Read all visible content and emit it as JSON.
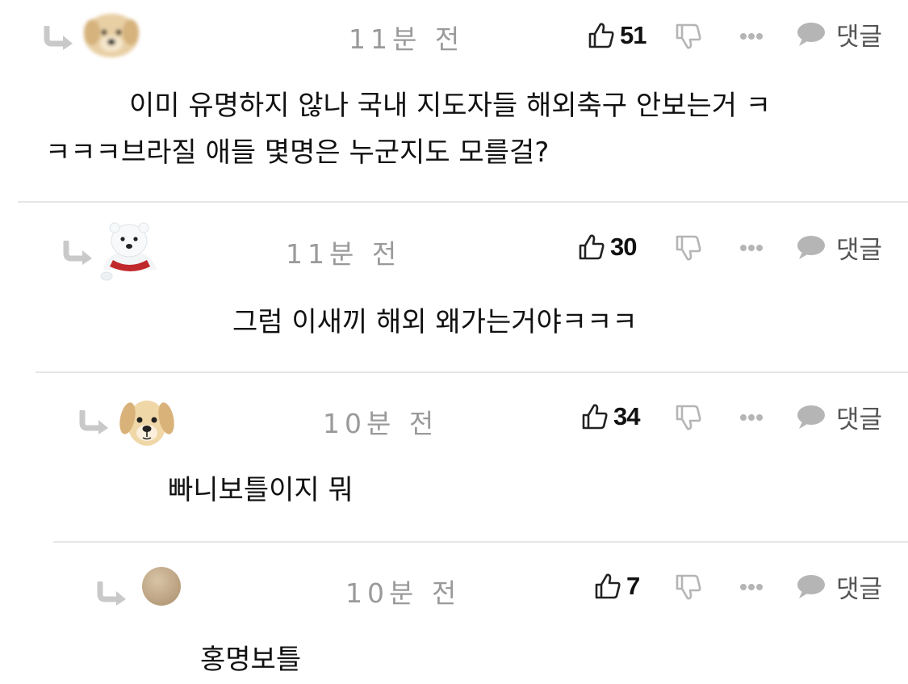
{
  "ui": {
    "reply_label": "댓글"
  },
  "colors": {
    "divider": "#e6e6e6",
    "icon_gray": "#b5b5b5",
    "time_gray": "#9a9a9a"
  },
  "comments": [
    {
      "avatar": "puppy-blurred-avatar",
      "time": "11분 전",
      "likes": "51",
      "text_line1": "이미 유명하지 않나 국내 지도자들 해외축구 안보는거 ㅋ",
      "text_line2": "ㅋㅋㅋ브라질 애들 몇명은 누군지도 모를걸?"
    },
    {
      "avatar": "polar-bear-avatar",
      "time": "11분 전",
      "likes": "30",
      "text_line1": "그럼 이새끼 해외 왜가는거야ㅋㅋㅋ"
    },
    {
      "avatar": "puppy-avatar",
      "time": "10분 전",
      "likes": "34",
      "text_line1": "빠니보틀이지 뭐"
    },
    {
      "avatar": "beige-circle-avatar",
      "time": "10분 전",
      "likes": "7",
      "text_line1": "홍명보틀"
    }
  ]
}
